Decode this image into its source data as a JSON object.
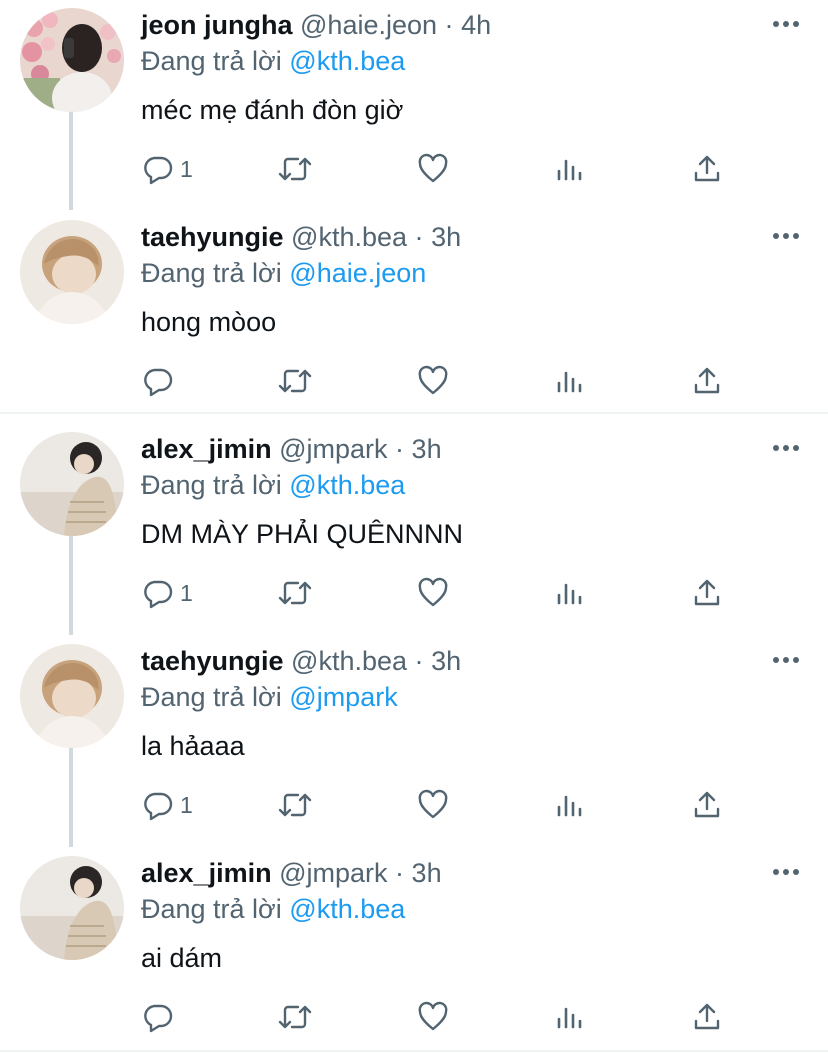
{
  "tweets": [
    {
      "name": "jeon jungha",
      "handle": "@haie.jeon",
      "dot": "·",
      "time": "4h",
      "reply_prefix": "Đang trả lời",
      "reply_to": "@kth.bea",
      "text": "méc mẹ đánh đòn giờ",
      "reply_count": "1",
      "avatar": "girl-flowers-avatar"
    },
    {
      "name": "taehyungie",
      "handle": "@kth.bea",
      "dot": "·",
      "time": "3h",
      "reply_prefix": "Đang trả lời",
      "reply_to": "@haie.jeon",
      "text": "hong mòoo",
      "reply_count": "",
      "avatar": "blond-man-avatar"
    },
    {
      "name": "alex_jimin",
      "handle": "@jmpark",
      "dot": "·",
      "time": "3h",
      "reply_prefix": "Đang trả lời",
      "reply_to": "@kth.bea",
      "text": "DM MÀY PHẢI QUÊNNNN",
      "reply_count": "1",
      "avatar": "dark-hair-man-avatar"
    },
    {
      "name": "taehyungie",
      "handle": "@kth.bea",
      "dot": "·",
      "time": "3h",
      "reply_prefix": "Đang trả lời",
      "reply_to": "@jmpark",
      "text": "la hảaaa",
      "reply_count": "1",
      "avatar": "blond-man-avatar"
    },
    {
      "name": "alex_jimin",
      "handle": "@jmpark",
      "dot": "·",
      "time": "3h",
      "reply_prefix": "Đang trả lời",
      "reply_to": "@kth.bea",
      "text": "ai dám",
      "reply_count": "",
      "avatar": "dark-hair-man-avatar"
    }
  ],
  "colors": {
    "text": "#0f1419",
    "secondary": "#536471",
    "accent": "#1d9bf0",
    "thread_line": "#cfd9de",
    "separator": "#eff3f4"
  },
  "icons": {
    "reply": "reply-icon",
    "retweet": "retweet-icon",
    "like": "heart-icon",
    "views": "views-icon",
    "share": "share-icon",
    "more": "more-icon"
  }
}
